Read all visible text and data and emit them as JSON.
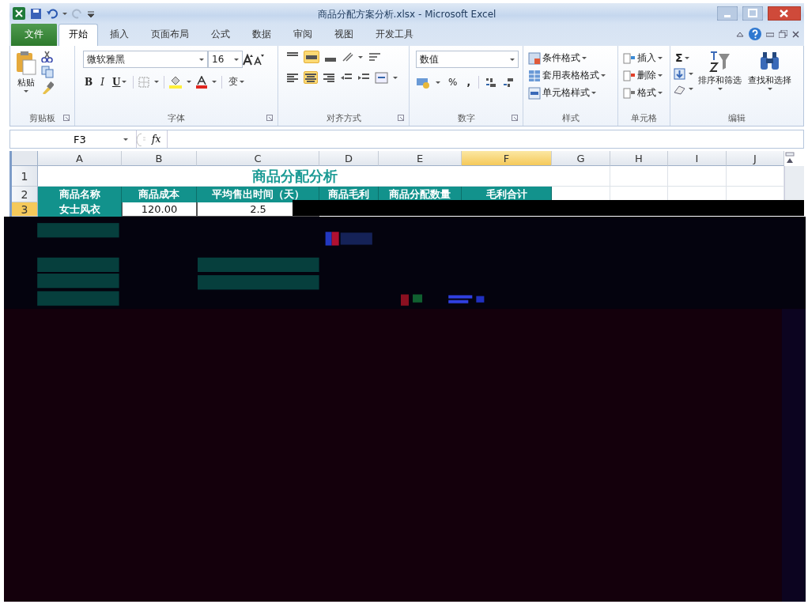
{
  "window": {
    "title": "商品分配方案分析.xlsx - Microsoft Excel"
  },
  "tabs": [
    {
      "label": "文件",
      "kind": "file",
      "selected": false
    },
    {
      "label": "开始",
      "kind": "tab",
      "selected": true
    },
    {
      "label": "插入",
      "kind": "tab",
      "selected": false
    },
    {
      "label": "页面布局",
      "kind": "tab",
      "selected": false
    },
    {
      "label": "公式",
      "kind": "tab",
      "selected": false
    },
    {
      "label": "数据",
      "kind": "tab",
      "selected": false
    },
    {
      "label": "审阅",
      "kind": "tab",
      "selected": false
    },
    {
      "label": "视图",
      "kind": "tab",
      "selected": false
    },
    {
      "label": "开发工具",
      "kind": "tab",
      "selected": false
    }
  ],
  "ribbon": {
    "clipboard": {
      "paste": "粘贴",
      "label": "剪贴板"
    },
    "font": {
      "font_name": "微软雅黑",
      "font_size": "16",
      "bold": "B",
      "italic": "I",
      "underline": "U",
      "phonetic": "变",
      "label": "字体"
    },
    "alignment": {
      "label": "对齐方式"
    },
    "number": {
      "format": "数值",
      "percent": "%",
      "comma": ",",
      "label": "数字"
    },
    "styles": {
      "items": [
        "条件格式",
        "套用表格格式",
        "单元格样式"
      ],
      "label": "样式"
    },
    "cells": {
      "items": [
        "插入",
        "删除",
        "格式"
      ],
      "label": "单元格"
    },
    "editing": {
      "sum": "Σ",
      "sort": "排序和筛选",
      "find": "查找和选择",
      "label": "编辑"
    }
  },
  "formula_bar": {
    "name_box": "F3",
    "fx": "fx"
  },
  "sheet": {
    "columns": [
      {
        "label": "A",
        "selected": false
      },
      {
        "label": "B",
        "selected": false
      },
      {
        "label": "C",
        "selected": false
      },
      {
        "label": "D",
        "selected": false
      },
      {
        "label": "E",
        "selected": false
      },
      {
        "label": "F",
        "selected": true
      },
      {
        "label": "G",
        "selected": false
      },
      {
        "label": "H",
        "selected": false
      },
      {
        "label": "I",
        "selected": false
      },
      {
        "label": "J",
        "selected": false
      }
    ],
    "title_row": {
      "number": "1",
      "selected": false,
      "title": "商品分配分析"
    },
    "rows": [
      {
        "number": "2",
        "selected": false,
        "cells": [
          {
            "text": "商品名称",
            "kind": "header"
          },
          {
            "text": "商品成本",
            "kind": "header"
          },
          {
            "text": "平均售出时间（天）",
            "kind": "header"
          },
          {
            "text": "商品毛利",
            "kind": "header"
          },
          {
            "text": "商品分配数量",
            "kind": "header"
          },
          {
            "text": "毛利合计",
            "kind": "header"
          }
        ]
      },
      {
        "number": "3",
        "selected": true,
        "cells": [
          {
            "text": "女士风衣",
            "kind": "header"
          },
          {
            "text": "120.00",
            "kind": "value"
          },
          {
            "text": "2.5",
            "kind": "value"
          }
        ]
      }
    ]
  }
}
